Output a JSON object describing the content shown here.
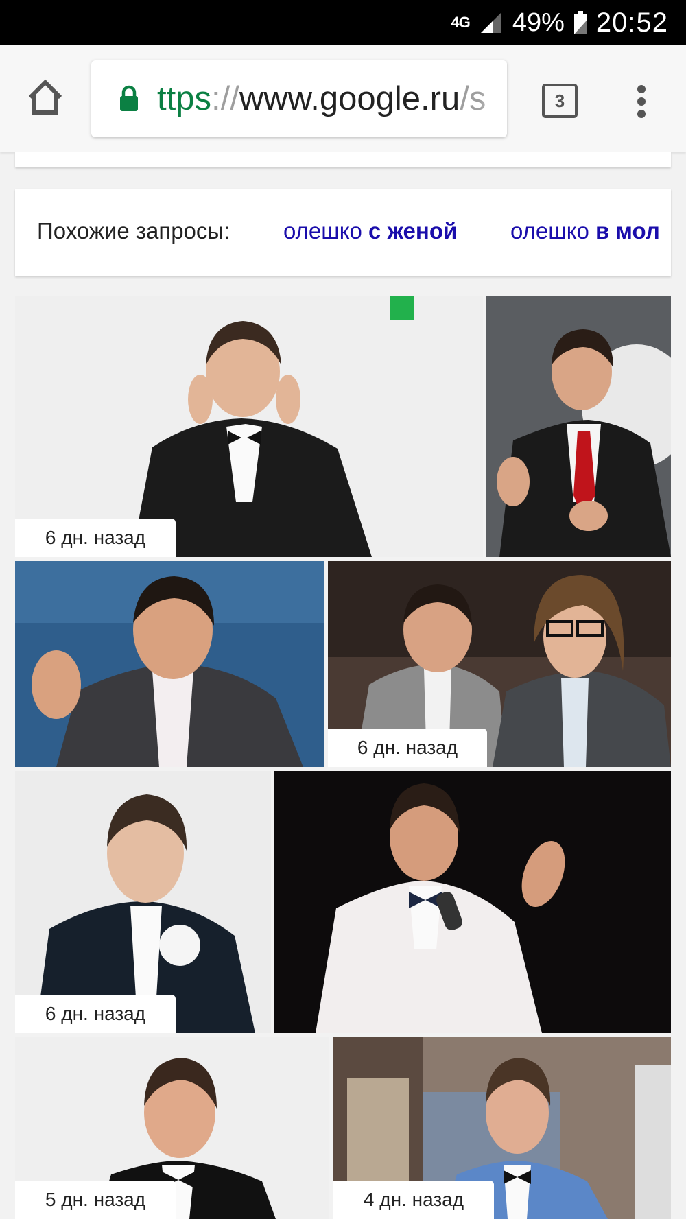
{
  "status_bar": {
    "network": "4G",
    "battery_percent": "49%",
    "time": "20:52"
  },
  "browser": {
    "url_scheme": "ttps",
    "url_sep": "://",
    "url_host": "www.google.ru",
    "url_rest": "/s",
    "tab_count": "3"
  },
  "related_searches": {
    "label": "Похожие запросы:",
    "items": [
      {
        "prefix": "олешко ",
        "bold": "с женой"
      },
      {
        "prefix": "олешко ",
        "bold": "в мол"
      }
    ]
  },
  "images": [
    {
      "badge": "6 дн. назад"
    },
    {
      "badge": ""
    },
    {
      "badge": ""
    },
    {
      "badge": "6 дн. назад"
    },
    {
      "badge": "6 дн. назад"
    },
    {
      "badge": ""
    },
    {
      "badge": "5 дн. назад"
    },
    {
      "badge": "4 дн. назад"
    }
  ],
  "colors": {
    "link": "#1a0dab",
    "secure": "#0b8043",
    "source_logo": "#22b14c"
  }
}
